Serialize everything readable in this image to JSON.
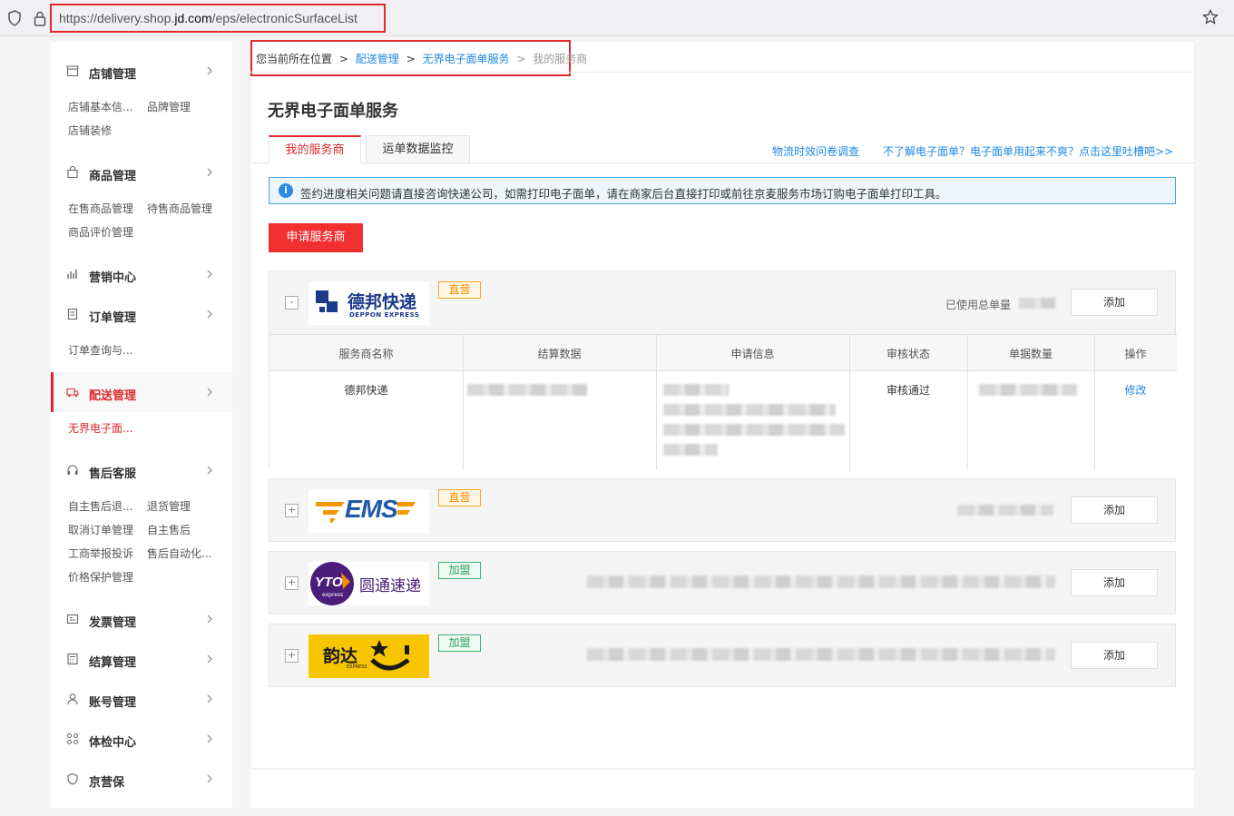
{
  "browser": {
    "url_prefix": "https://delivery.shop.",
    "url_domain": "jd.com",
    "url_path": "/eps/electronicSurfaceList"
  },
  "sidebar": {
    "groups": [
      {
        "title": "店铺管理",
        "icon": "store-icon",
        "items": [
          "店铺基本信...",
          "品牌管理",
          "店铺装修"
        ]
      },
      {
        "title": "商品管理",
        "icon": "bag-icon",
        "items": [
          "在售商品管理",
          "待售商品管理",
          "商品评价管理"
        ]
      },
      {
        "title": "营销中心",
        "icon": "bar-chart-icon",
        "items": []
      },
      {
        "title": "订单管理",
        "icon": "document-icon",
        "items": [
          "订单查询与..."
        ]
      },
      {
        "title": "配送管理",
        "icon": "truck-icon",
        "items": [
          "无界电子面..."
        ]
      },
      {
        "title": "售后客服",
        "icon": "headset-icon",
        "items": [
          "自主售后退...",
          "退货管理",
          "取消订单管理",
          "自主售后",
          "工商举报投诉",
          "售后自动化...",
          "价格保护管理"
        ]
      },
      {
        "title": "发票管理",
        "icon": "invoice-icon",
        "items": []
      },
      {
        "title": "结算管理",
        "icon": "calculator-icon",
        "items": []
      },
      {
        "title": "账号管理",
        "icon": "user-icon",
        "items": []
      },
      {
        "title": "体检中心",
        "icon": "grid-icon",
        "items": []
      },
      {
        "title": "京营保",
        "icon": "shield-heart-icon",
        "items": []
      }
    ]
  },
  "breadcrumb": {
    "prefix": "您当前所在位置",
    "sep1": ">",
    "level1": "配送管理",
    "sep2": ">",
    "level2": "无界电子面单服务",
    "sep3": ">",
    "current": "我的服务商"
  },
  "page_title": "无界电子面单服务",
  "tabs": [
    {
      "label": "我的服务商",
      "active": true
    },
    {
      "label": "运单数据监控",
      "active": false
    }
  ],
  "top_links": {
    "survey": "物流时效问卷调查",
    "help": "不了解电子面单？电子面单用起来不爽？点击这里吐槽吧>>"
  },
  "notice": {
    "icon": "info-icon",
    "text": "签约进度相关问题请直接咨询快递公司，如需打印电子面单，请在商家后台直接打印或前往京麦服务市场订购电子面单打印工具。"
  },
  "apply_button": "申请服务商",
  "carriers": [
    {
      "name": "德邦快递",
      "logo_cn": "德邦快递",
      "logo_en": "DEPPON EXPRESS",
      "badge": "直营",
      "toggle": "-",
      "used_label": "已使用总单量",
      "add_label": "添加",
      "table": {
        "headers": [
          "服务商名称",
          "结算数据",
          "申请信息",
          "审核状态",
          "单据数量",
          "操作"
        ],
        "row": {
          "name": "德邦快递",
          "status": "审核通过",
          "action": "修改"
        }
      }
    },
    {
      "name": "EMS",
      "logo_text": "EMS",
      "badge": "直营",
      "toggle": "+",
      "add_label": "添加"
    },
    {
      "name": "圆通速递",
      "logo_text": "圆通速递",
      "logo_mark": "YTO",
      "logo_sub": "express",
      "badge": "加盟",
      "toggle": "+",
      "add_label": "添加"
    },
    {
      "name": "韵达",
      "logo_text": "韵达",
      "logo_sub": "EXPRESS",
      "badge": "加盟",
      "toggle": "+",
      "add_label": "添加"
    }
  ],
  "colors": {
    "accent": "#e0282d",
    "link": "#1e88e5",
    "button": "#f23030"
  }
}
